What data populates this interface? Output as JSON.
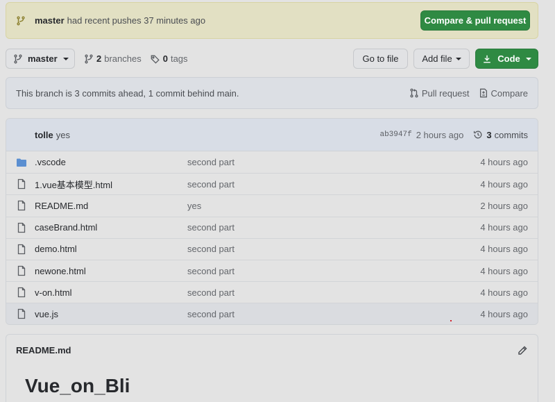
{
  "banner": {
    "branch": "master",
    "message": "had recent pushes 37 minutes ago",
    "button_label": "Compare & pull request"
  },
  "toolbar": {
    "branch_select": "master",
    "branches_count": "2",
    "branches_label": "branches",
    "tags_count": "0",
    "tags_label": "tags",
    "go_to_file": "Go to file",
    "add_file": "Add file",
    "code": "Code"
  },
  "branch_info": {
    "text": "This branch is 3 commits ahead, 1 commit behind main.",
    "pull_request": "Pull request",
    "compare": "Compare"
  },
  "latest_commit": {
    "author": "tolle",
    "message": "yes",
    "sha": "ab3947f",
    "time": "2 hours ago",
    "commits_count": "3",
    "commits_label": "commits"
  },
  "files": [
    {
      "name": ".vscode",
      "type": "folder-icon",
      "message": "second part",
      "age": "4 hours ago"
    },
    {
      "name": "1.vue基本模型.html",
      "type": "file-icon",
      "message": "second part",
      "age": "4 hours ago"
    },
    {
      "name": "README.md",
      "type": "file-icon",
      "message": "yes",
      "age": "2 hours ago"
    },
    {
      "name": "caseBrand.html",
      "type": "file-icon",
      "message": "second part",
      "age": "4 hours ago"
    },
    {
      "name": "demo.html",
      "type": "file-icon",
      "message": "second part",
      "age": "4 hours ago"
    },
    {
      "name": "newone.html",
      "type": "file-icon",
      "message": "second part",
      "age": "4 hours ago"
    },
    {
      "name": "v-on.html",
      "type": "file-icon",
      "message": "second part",
      "age": "4 hours ago"
    },
    {
      "name": "vue.js",
      "type": "file-icon",
      "message": "second part",
      "age": "4 hours ago"
    }
  ],
  "readme": {
    "title": "README.md",
    "heading": "Vue_on_Bli"
  },
  "colors": {
    "accent_green": "#2f8a43",
    "banner_bg": "#e2e0c3",
    "folder_blue": "#5b8fd1"
  }
}
